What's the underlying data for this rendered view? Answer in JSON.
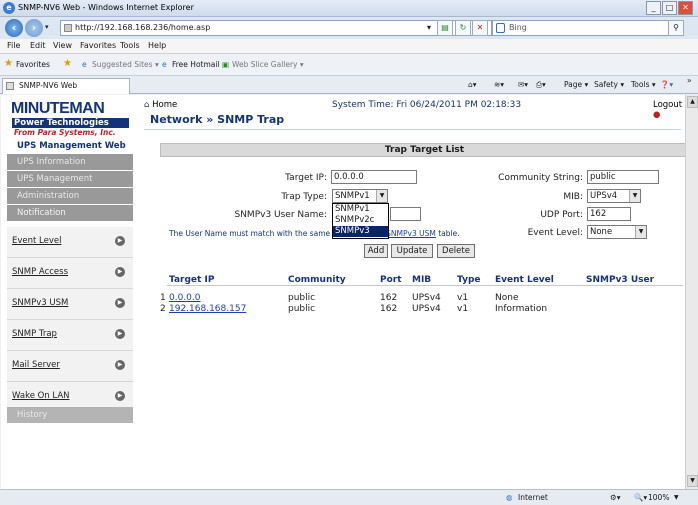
{
  "window": {
    "title": "SNMP-NV6 Web - Windows Internet Explorer"
  },
  "addressbar": {
    "url": "http://192.168.168.236/home.asp",
    "search_placeholder": "Bing"
  },
  "menubar": {
    "items": [
      "File",
      "Edit",
      "View",
      "Favorites",
      "Tools",
      "Help"
    ]
  },
  "favbar": {
    "favorites": "Favorites",
    "suggested": "Suggested Sites ▾",
    "hotmail": "Free Hotmail",
    "gallery": "Web Slice Gallery ▾"
  },
  "tab": {
    "label": "SNMP-NV6 Web"
  },
  "commandbar": {
    "page": "Page ▾",
    "safety": "Safety ▾",
    "tools": "Tools ▾"
  },
  "status": {
    "zone": "Internet",
    "zoom": "100%"
  },
  "brand": {
    "name": "MINUTEMAN",
    "tagline": "Power Technologies",
    "company": "From Para Systems, Inc.",
    "product": "UPS Management Web"
  },
  "header": {
    "home": "Home",
    "system_time": "System Time: Fri 06/24/2011 PM 02:18:33",
    "logout": "Logout",
    "breadcrumb": "Network » SNMP Trap"
  },
  "sidebar": {
    "sections": [
      "UPS Information",
      "UPS Management",
      "Administration",
      "Notification"
    ],
    "items": [
      "Event Level",
      "SNMP Access",
      "SNMPv3 USM",
      "SNMP Trap",
      "Mail Server",
      "Wake On LAN"
    ],
    "history": "History"
  },
  "form": {
    "title": "Trap Target List",
    "target_ip_label": "Target IP:",
    "target_ip": "0.0.0.0",
    "community_label": "Community String:",
    "community": "public",
    "trap_type_label": "Trap Type:",
    "trap_type": "SNMPv1",
    "trap_options": [
      "SNMPv1",
      "SNMPv2c",
      "SNMPv3"
    ],
    "mib_label": "MIB:",
    "mib": "UPSv4",
    "user_label": "SNMPv3 User Name:",
    "user": "",
    "udp_label": "UDP Port:",
    "udp": "162",
    "note_prefix": "The User Name must match with the same",
    "note_link": "SNMPv3 USM",
    "note_suffix": "table.",
    "event_label": "Event Level:",
    "event": "None",
    "add": "Add",
    "update": "Update",
    "delete": "Delete"
  },
  "table": {
    "headers": [
      "Target IP",
      "Community",
      "Port",
      "MIB",
      "Type",
      "Event Level",
      "SNMPv3 User"
    ],
    "rows": [
      {
        "index": "1",
        "ip": "0.0.0.0",
        "community": "public",
        "port": "162",
        "mib": "UPSv4",
        "type": "v1",
        "event": "None",
        "user": ""
      },
      {
        "index": "2",
        "ip": "192.168.168.157",
        "community": "public",
        "port": "162",
        "mib": "UPSv4",
        "type": "v1",
        "event": "Information",
        "user": ""
      }
    ]
  },
  "colors": {
    "brand_blue": "#14337a",
    "menu_grey": "#999999",
    "link": "#1b3fae",
    "selected": "#0a246a"
  }
}
